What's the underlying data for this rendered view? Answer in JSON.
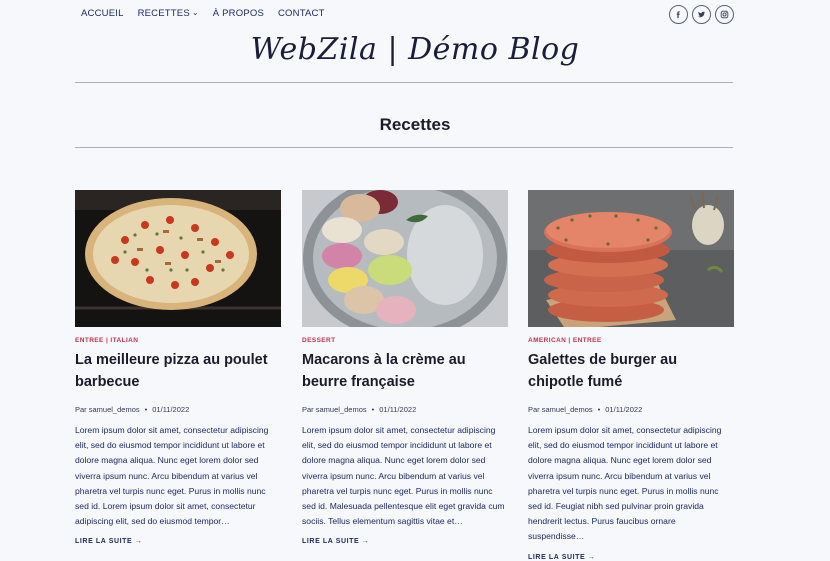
{
  "nav": {
    "items": [
      "ACCUEIL",
      "RECETTES",
      "À PROPOS",
      "CONTACT"
    ],
    "recettes_chevron": "⌄"
  },
  "social": {
    "facebook": "f",
    "twitter": "twitter-icon",
    "instagram": "instagram-icon"
  },
  "site_title": "WebZila | Démo Blog",
  "page_title": "Recettes",
  "posts": [
    {
      "category": "ENTREE | ITALIAN",
      "title": "La meilleure pizza au poulet barbecue",
      "author": "Par samuel_demos",
      "date": "01/11/2022",
      "excerpt": "Lorem ipsum dolor sit amet, consectetur adipiscing elit, sed do eiusmod tempor incididunt ut labore et dolore magna aliqua. Nunc eget lorem dolor sed viverra ipsum nunc. Arcu bibendum at varius vel pharetra vel turpis nunc eget. Purus in mollis nunc sed id. Lorem ipsum dolor sit amet, consectetur adipiscing elit, sed do eiusmod tempor…",
      "more": "LIRE LA SUITE →"
    },
    {
      "category": "DESSERT",
      "title": "Macarons à la crème au beurre française",
      "author": "Par samuel_demos",
      "date": "01/11/2022",
      "excerpt": "Lorem ipsum dolor sit amet, consectetur adipiscing elit, sed do eiusmod tempor incididunt ut labore et dolore magna aliqua. Nunc eget lorem dolor sed viverra ipsum nunc. Arcu bibendum at varius vel pharetra vel turpis nunc eget. Purus in mollis nunc sed id. Malesuada pellentesque elit eget gravida cum sociis. Tellus elementum sagittis vitae et…",
      "more": "LIRE LA SUITE →"
    },
    {
      "category": "AMERICAN | ENTREE",
      "title": "Galettes de burger au chipotle fumé",
      "author": "Par samuel_demos",
      "date": "01/11/2022",
      "excerpt": "Lorem ipsum dolor sit amet, consectetur adipiscing elit, sed do eiusmod tempor incididunt ut labore et dolore magna aliqua. Nunc eget lorem dolor sed viverra ipsum nunc. Arcu bibendum at varius vel pharetra vel turpis nunc eget. Purus in mollis nunc sed id. Feugiat nibh sed pulvinar proin gravida hendrerit lectus. Purus faucibus ornare suspendisse…",
      "more": "LIRE LA SUITE →"
    }
  ],
  "colors": {
    "accent": "#c2324b",
    "nav": "#1d2a66",
    "background": "#f7f8fb"
  }
}
